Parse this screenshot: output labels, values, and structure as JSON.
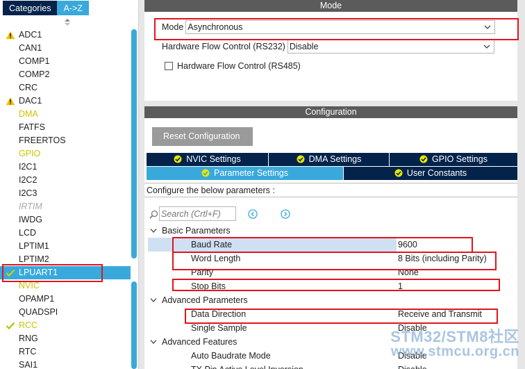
{
  "left_panel": {
    "tabs": [
      {
        "label": "Categories",
        "active": false
      },
      {
        "label": "A->Z",
        "active": true
      }
    ],
    "items": [
      {
        "label": "ADC1",
        "status": "warning"
      },
      {
        "label": "CAN1",
        "status": "normal"
      },
      {
        "label": "COMP1",
        "status": "normal"
      },
      {
        "label": "COMP2",
        "status": "normal"
      },
      {
        "label": "CRC",
        "status": "normal"
      },
      {
        "label": "DAC1",
        "status": "warning"
      },
      {
        "label": "DMA",
        "status": "yellow"
      },
      {
        "label": "FATFS",
        "status": "normal"
      },
      {
        "label": "FREERTOS",
        "status": "normal"
      },
      {
        "label": "GPIO",
        "status": "yellow"
      },
      {
        "label": "I2C1",
        "status": "normal"
      },
      {
        "label": "I2C2",
        "status": "normal"
      },
      {
        "label": "I2C3",
        "status": "normal"
      },
      {
        "label": "IRTIM",
        "status": "disabled"
      },
      {
        "label": "IWDG",
        "status": "normal"
      },
      {
        "label": "LCD",
        "status": "normal"
      },
      {
        "label": "LPTIM1",
        "status": "normal"
      },
      {
        "label": "LPTIM2",
        "status": "normal"
      },
      {
        "label": "LPUART1",
        "status": "selected"
      },
      {
        "label": "NVIC",
        "status": "yellow"
      },
      {
        "label": "OPAMP1",
        "status": "normal"
      },
      {
        "label": "QUADSPI",
        "status": "normal"
      },
      {
        "label": "RCC",
        "status": "yellow-check"
      },
      {
        "label": "RNG",
        "status": "normal"
      },
      {
        "label": "RTC",
        "status": "normal"
      },
      {
        "label": "SAI1",
        "status": "normal"
      }
    ]
  },
  "mode_panel": {
    "header": "Mode",
    "mode": {
      "label": "Mode",
      "value": "Asynchronous"
    },
    "flow_rs232": {
      "label": "Hardware Flow Control (RS232)",
      "value": "Disable"
    },
    "flow_rs485": {
      "label": "Hardware Flow Control (RS485)",
      "checked": false
    }
  },
  "config_panel": {
    "header": "Configuration",
    "reset_label": "Reset Configuration",
    "tabs_row1": [
      "NVIC Settings",
      "DMA Settings",
      "GPIO Settings"
    ],
    "tabs_row2": [
      "Parameter Settings",
      "User Constants"
    ],
    "active_tab": "Parameter Settings",
    "hint": "Configure the below parameters :",
    "search_placeholder": "Search (Crtl+F)",
    "groups": [
      {
        "name": "Basic Parameters",
        "params": [
          {
            "name": "Baud Rate",
            "value": "9600"
          },
          {
            "name": "Word Length",
            "value": "8 Bits (including Parity)"
          },
          {
            "name": "Parity",
            "value": "None"
          },
          {
            "name": "Stop Bits",
            "value": "1"
          }
        ]
      },
      {
        "name": "Advanced Parameters",
        "params": [
          {
            "name": "Data Direction",
            "value": "Receive and Transmit"
          },
          {
            "name": "Single Sample",
            "value": "Disable"
          }
        ]
      },
      {
        "name": "Advanced Features",
        "params": [
          {
            "name": "Auto Baudrate Mode",
            "value": "Disable"
          },
          {
            "name": "TX Pin Active Level Inversion",
            "value": "Disable"
          }
        ]
      }
    ]
  },
  "watermark": {
    "line1": "STM32/STM8社区",
    "line2": "www.stmcu.org.cn"
  },
  "colors": {
    "accent_blue": "#39a9dc",
    "dark_navy": "#03234b",
    "header_gray": "#5b5b5b",
    "highlight_red": "#e0141e",
    "warning_yellow": "#f2c200",
    "check_green": "#b5c400"
  }
}
